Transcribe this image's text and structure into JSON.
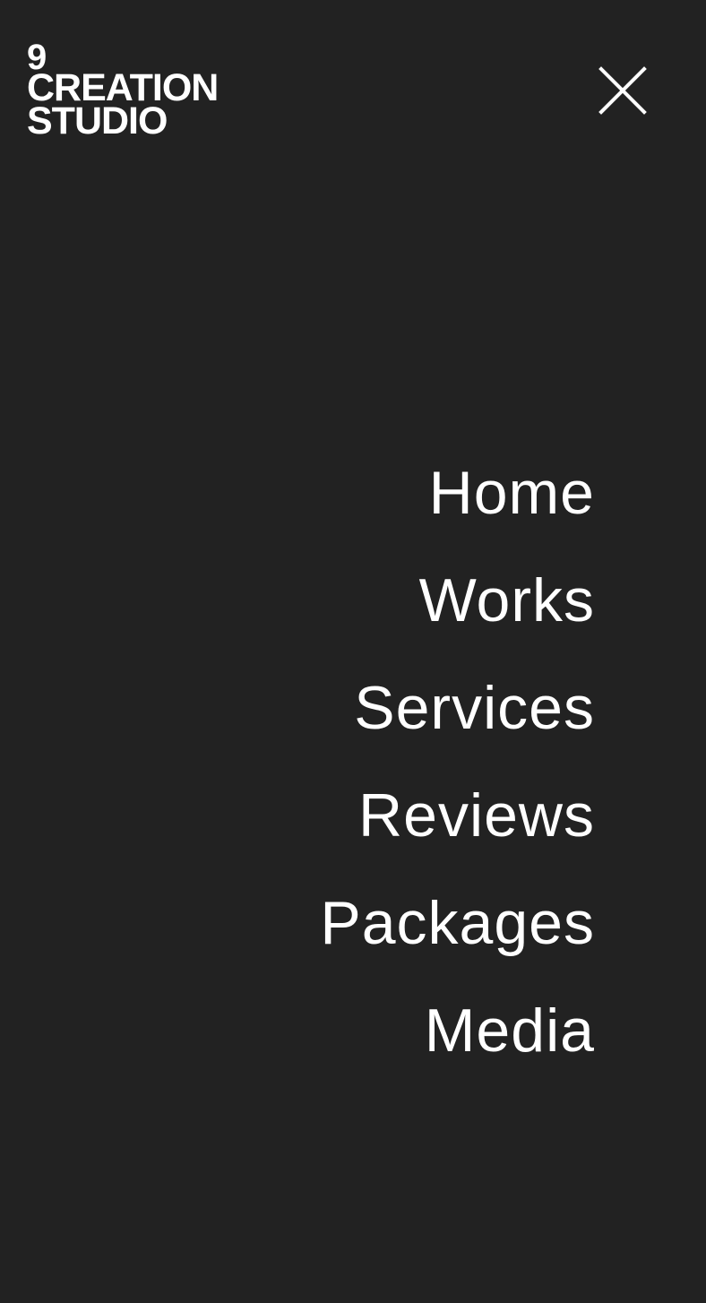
{
  "colors": {
    "background": "#222222",
    "foreground": "#ffffff"
  },
  "header": {
    "logo": {
      "number": "9",
      "line1": "CREATION",
      "line2": "STUDIO"
    },
    "close_icon": "close-icon"
  },
  "nav": {
    "items": [
      {
        "label": "Home"
      },
      {
        "label": "Works"
      },
      {
        "label": "Services"
      },
      {
        "label": "Reviews"
      },
      {
        "label": "Packages"
      },
      {
        "label": "Media"
      }
    ]
  }
}
